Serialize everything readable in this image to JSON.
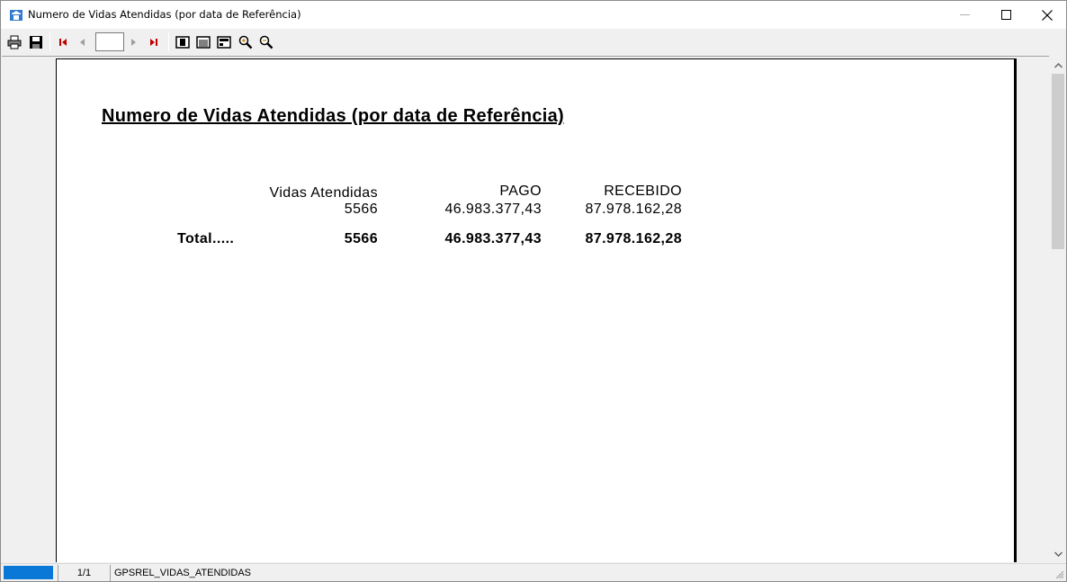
{
  "window": {
    "title": "Numero de Vidas Atendidas (por data de Referência)",
    "minimize_glyph": "—",
    "maximize_glyph": "☐",
    "close_glyph": "✕"
  },
  "toolbar": {
    "page_value": "",
    "icons": [
      "printer-icon",
      "save-icon",
      "first-page-icon",
      "prev-page-icon",
      "next-page-icon",
      "last-page-icon",
      "whole-page-icon",
      "page-width-icon",
      "view-100-icon",
      "zoom-in-icon",
      "zoom-out-icon"
    ]
  },
  "report": {
    "title": "Numero de Vidas Atendidas (por data de Referência)",
    "headers": {
      "vidas": "Vidas Atendidas",
      "pago": "PAGO",
      "recebido": "RECEBIDO"
    },
    "row": {
      "vidas": "5566",
      "pago": "46.983.377,43",
      "recebido": "87.978.162,28"
    },
    "total": {
      "label": "Total.....",
      "vidas": "5566",
      "pago": "46.983.377,43",
      "recebido": "87.978.162,28"
    }
  },
  "statusbar": {
    "page_count": "1/1",
    "report_name": "GPSREL_VIDAS_ATENDIDAS"
  },
  "colors": {
    "progress": "#0a78d7",
    "nav_red": "#c00000"
  }
}
